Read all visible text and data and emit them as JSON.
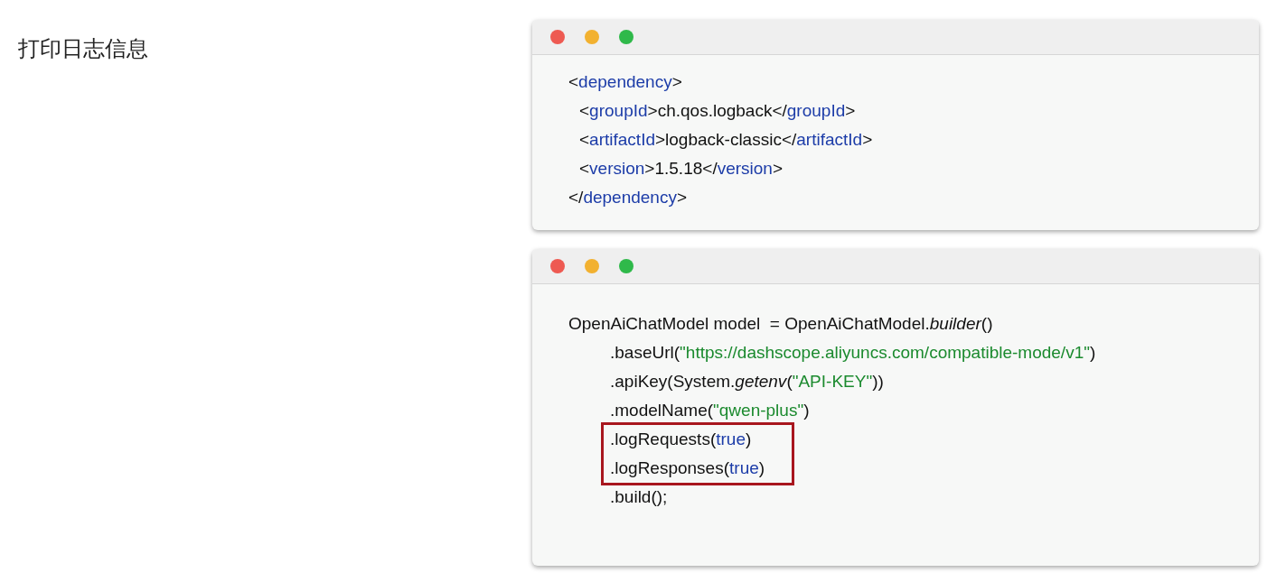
{
  "title": "打印日志信息",
  "code_windows": [
    {
      "lines": [
        {
          "kind": "outer",
          "highlighted": false,
          "tokens": [
            {
              "kind": "plain",
              "text": "<"
            },
            {
              "kind": "tag",
              "text": "dependency"
            },
            {
              "kind": "plain",
              "text": ">"
            }
          ]
        },
        {
          "kind": "inner",
          "highlighted": false,
          "tokens": [
            {
              "kind": "plain",
              "text": "<"
            },
            {
              "kind": "tag",
              "text": "groupId"
            },
            {
              "kind": "plain",
              "text": ">ch.qos.logback</"
            },
            {
              "kind": "tag",
              "text": "groupId"
            },
            {
              "kind": "plain",
              "text": ">"
            }
          ]
        },
        {
          "kind": "inner",
          "highlighted": false,
          "tokens": [
            {
              "kind": "plain",
              "text": "<"
            },
            {
              "kind": "tag",
              "text": "artifactId"
            },
            {
              "kind": "plain",
              "text": ">logback-classic</"
            },
            {
              "kind": "tag",
              "text": "artifactId"
            },
            {
              "kind": "plain",
              "text": ">"
            }
          ]
        },
        {
          "kind": "inner",
          "highlighted": false,
          "tokens": [
            {
              "kind": "plain",
              "text": "<"
            },
            {
              "kind": "tag",
              "text": "version"
            },
            {
              "kind": "plain",
              "text": ">1.5.18</"
            },
            {
              "kind": "tag",
              "text": "version"
            },
            {
              "kind": "plain",
              "text": ">"
            }
          ]
        },
        {
          "kind": "outer",
          "highlighted": false,
          "tokens": [
            {
              "kind": "plain",
              "text": "</"
            },
            {
              "kind": "tag",
              "text": "dependency"
            },
            {
              "kind": "plain",
              "text": ">"
            }
          ]
        }
      ]
    },
    {
      "lines": [
        {
          "kind": "outer",
          "highlighted": false,
          "tokens": [
            {
              "kind": "plain",
              "text": "OpenAiChatModel model  = OpenAiChatModel."
            },
            {
              "kind": "italic",
              "text": "builder"
            },
            {
              "kind": "plain",
              "text": "()"
            }
          ]
        },
        {
          "kind": "chained",
          "highlighted": false,
          "tokens": [
            {
              "kind": "plain",
              "text": ".baseUrl("
            },
            {
              "kind": "string",
              "text": "\"https://dashscope.aliyuncs.com/compatible-mode/v1\""
            },
            {
              "kind": "plain",
              "text": ")"
            }
          ]
        },
        {
          "kind": "chained",
          "highlighted": false,
          "tokens": [
            {
              "kind": "plain",
              "text": ".apiKey(System."
            },
            {
              "kind": "italic",
              "text": "getenv"
            },
            {
              "kind": "plain",
              "text": "("
            },
            {
              "kind": "string",
              "text": "\"API-KEY\""
            },
            {
              "kind": "plain",
              "text": "))"
            }
          ]
        },
        {
          "kind": "chained",
          "highlighted": false,
          "tokens": [
            {
              "kind": "plain",
              "text": ".modelName("
            },
            {
              "kind": "string",
              "text": "\"qwen-plus\""
            },
            {
              "kind": "plain",
              "text": ")"
            }
          ]
        },
        {
          "kind": "chained",
          "highlighted": true,
          "tokens": [
            {
              "kind": "plain",
              "text": ".logRequests("
            },
            {
              "kind": "keyword",
              "text": "true"
            },
            {
              "kind": "plain",
              "text": ")"
            }
          ]
        },
        {
          "kind": "chained",
          "highlighted": true,
          "tokens": [
            {
              "kind": "plain",
              "text": ".logResponses("
            },
            {
              "kind": "keyword",
              "text": "true"
            },
            {
              "kind": "plain",
              "text": ")"
            }
          ]
        },
        {
          "kind": "chained",
          "highlighted": false,
          "tokens": [
            {
              "kind": "plain",
              "text": ".build();"
            }
          ]
        }
      ]
    }
  ]
}
